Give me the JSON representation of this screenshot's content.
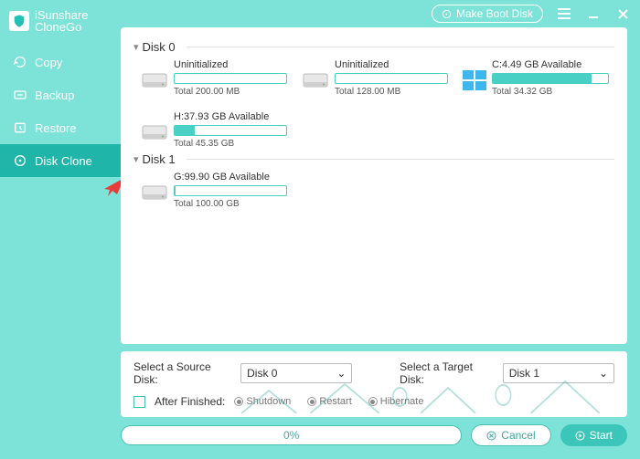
{
  "app": {
    "line1": "iSunshare",
    "line2": "CloneGo"
  },
  "nav": {
    "copy": "Copy",
    "backup": "Backup",
    "restore": "Restore",
    "diskclone": "Disk Clone"
  },
  "topbar": {
    "makeboot": "Make Boot Disk"
  },
  "disks": [
    {
      "name": "Disk 0",
      "parts": [
        {
          "label": "Uninitialized",
          "total": "Total 200.00 MB",
          "fill": 0,
          "icon": "hdd"
        },
        {
          "label": "Uninitialized",
          "total": "Total 128.00 MB",
          "fill": 0,
          "icon": "hdd"
        },
        {
          "label": "C:4.49 GB Available",
          "total": "Total 34.32 GB",
          "fill": 86,
          "icon": "win"
        },
        {
          "label": "H:37.93 GB Available",
          "total": "Total 45.35 GB",
          "fill": 18,
          "icon": "hdd"
        }
      ]
    },
    {
      "name": "Disk 1",
      "parts": [
        {
          "label": "G:99.90 GB Available",
          "total": "Total 100.00 GB",
          "fill": 1,
          "icon": "hdd"
        }
      ]
    }
  ],
  "selectors": {
    "source_lbl": "Select a Source Disk:",
    "source_val": "Disk 0",
    "target_lbl": "Select a Target Disk:",
    "target_val": "Disk 1",
    "after_lbl": "After Finished:",
    "shutdown": "Shutdown",
    "restart": "Restart",
    "hibernate": "Hibernate"
  },
  "actions": {
    "progress": "0%",
    "cancel": "Cancel",
    "start": "Start"
  }
}
